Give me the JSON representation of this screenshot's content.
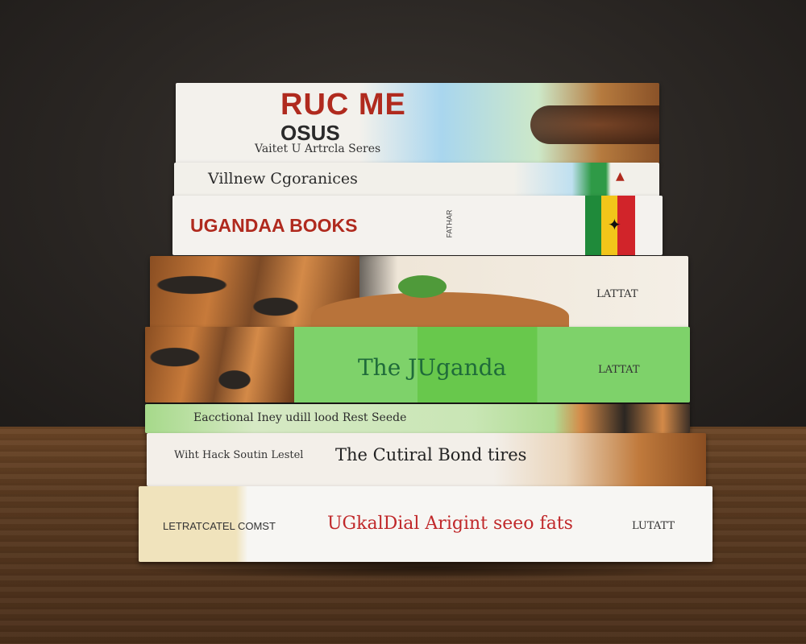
{
  "books": [
    {
      "spine_words": [
        "RUC ME",
        "OSUS"
      ],
      "series": "Vaitet U Artrcla Seres"
    },
    {
      "title": "Villnew Cgoranices"
    },
    {
      "title": "UGANDAA BOOKS",
      "publisher": "FATHAR"
    },
    {
      "publisher": "LATTAT"
    },
    {
      "title": "The JUganda",
      "publisher": "LATTAT"
    },
    {
      "title": "Eacctional Iney udill lood Rest Seede"
    },
    {
      "subtitle": "Wiht Hack Soutin Lestel",
      "title": "The Cutiral Bond tires"
    },
    {
      "subtitle": "LETRATCATEL COMST",
      "title": "UGkalDial Arigint seeo fats",
      "publisher": "LUTATT"
    }
  ],
  "colors": {
    "red": "#b02a1e",
    "green": "#1f8a3a",
    "yellow": "#f2c51a",
    "spine_green": "#7ed26a"
  }
}
